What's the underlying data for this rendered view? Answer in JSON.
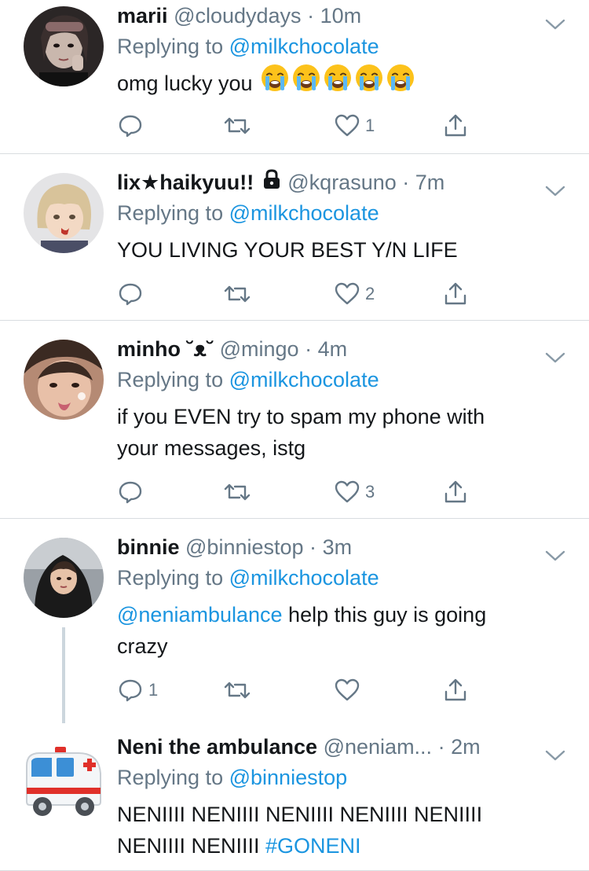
{
  "colors": {
    "link": "#1b95e0",
    "secondary": "#657786",
    "divider": "#d9dde0",
    "text": "#14171a"
  },
  "tweets": [
    {
      "name": "marii",
      "handle": "@cloudydays",
      "dot": "·",
      "time": "10m",
      "replying_label": "Replying to",
      "replying_to": "@milkchocolate",
      "text": "omg lucky you",
      "emoji": [
        "crying-face",
        "crying-face",
        "crying-face",
        "crying-face",
        "crying-face"
      ],
      "counts": {
        "reply": "",
        "retweet": "",
        "like": "1"
      }
    },
    {
      "name": "lix★haikyuu!!",
      "locked": true,
      "handle": "@kqrasuno",
      "dot": "·",
      "time": "7m",
      "replying_label": "Replying to",
      "replying_to": "@milkchocolate",
      "text": "YOU LIVING YOUR BEST Y/N LIFE",
      "counts": {
        "reply": "",
        "retweet": "",
        "like": "2"
      }
    },
    {
      "name": "minho ˘ᴥ˘",
      "handle": "@mingo",
      "dot": "·",
      "time": "4m",
      "replying_label": "Replying to",
      "replying_to": "@milkchocolate",
      "text_line1": "if you EVEN try to spam my phone with",
      "text_line2": "your messages, istg",
      "counts": {
        "reply": "",
        "retweet": "",
        "like": "3"
      }
    },
    {
      "name": "binnie",
      "handle": "@binniestop",
      "dot": "·",
      "time": "3m",
      "replying_label": "Replying to",
      "replying_to": "@milkchocolate",
      "mention": "@neniambulance",
      "text_line1": " help this guy is going",
      "text_line2": "crazy",
      "counts": {
        "reply": "1",
        "retweet": "",
        "like": ""
      }
    },
    {
      "name": "Neni the ambulance",
      "handle": "@neniam...",
      "dot": "·",
      "time": "2m",
      "replying_label": "Replying to",
      "replying_to": "@binniestop",
      "text_line1": "NENIIII NENIIII NENIIII NENIIII NENIIII",
      "text_line2": "NENIIII NENIIII ",
      "hashtag": "#GONENI"
    }
  ]
}
